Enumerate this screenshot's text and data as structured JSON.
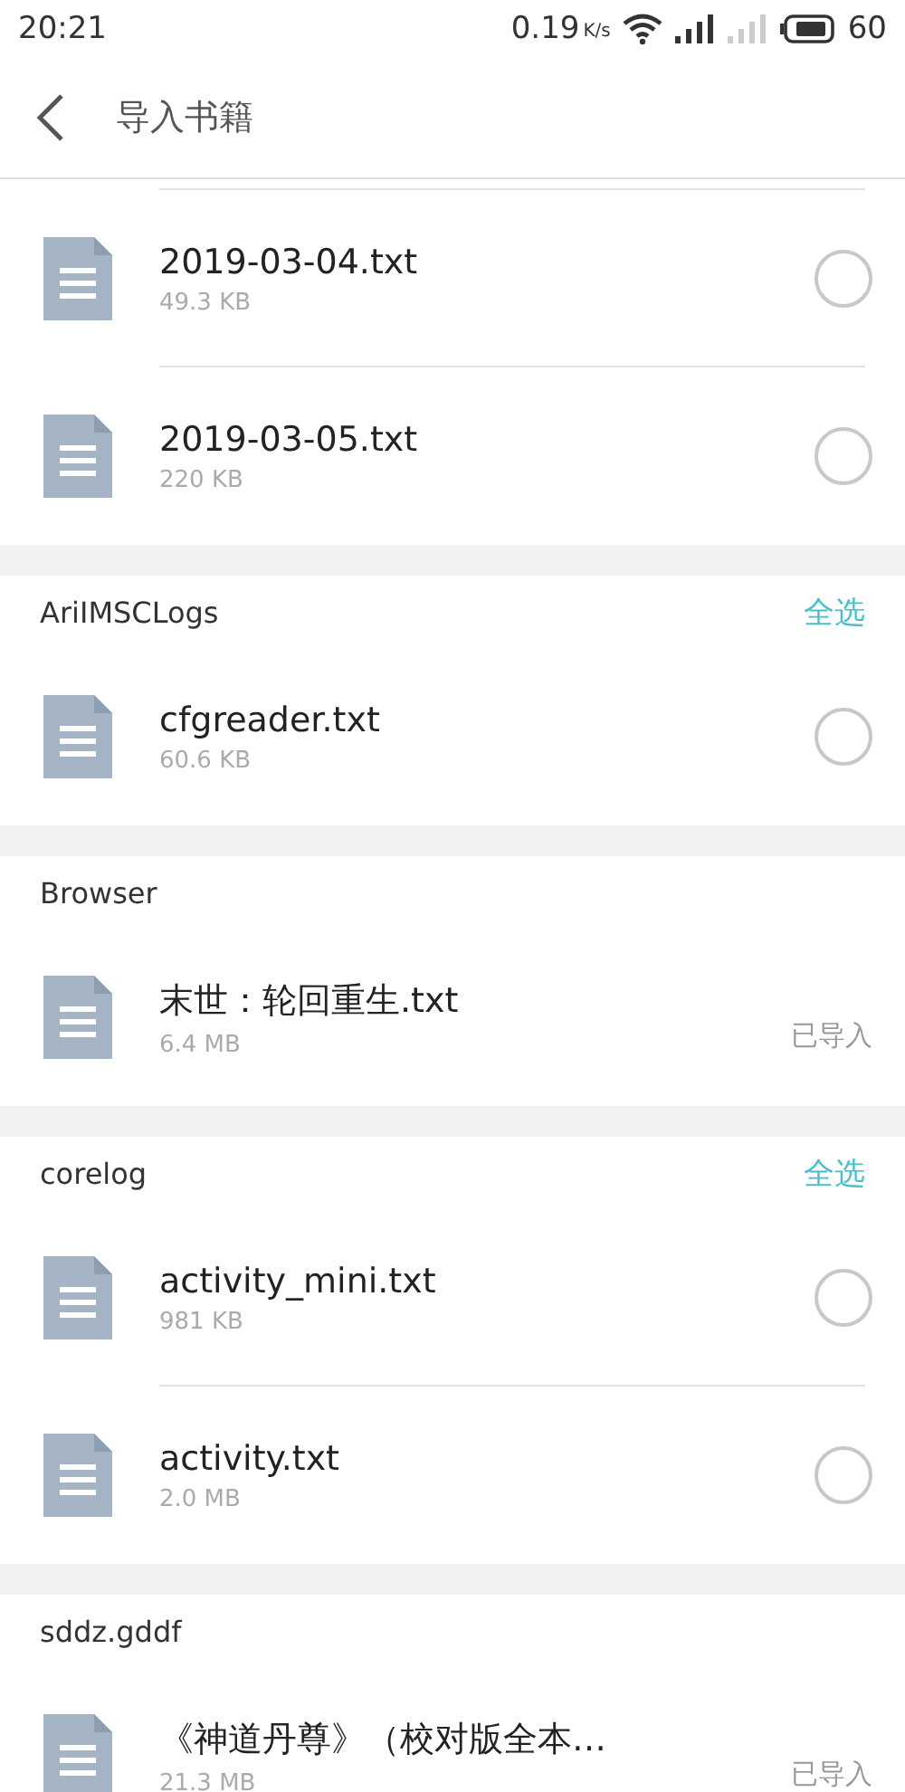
{
  "status_bar": {
    "time": "20:21",
    "speed": "0.19",
    "speed_unit": "K/s",
    "battery": "60"
  },
  "header": {
    "title": "导入书籍"
  },
  "sections": [
    {
      "files": [
        {
          "name": "2019-03-04.txt",
          "size": "49.3 KB",
          "kind": "select",
          "selected": false
        },
        {
          "name": "2019-03-05.txt",
          "size": "220 KB",
          "kind": "select",
          "selected": false
        }
      ]
    },
    {
      "title": "AriIMSCLogs",
      "select_all": "全选",
      "files": [
        {
          "name": "cfgreader.txt",
          "size": "60.6 KB",
          "kind": "select",
          "selected": false
        }
      ]
    },
    {
      "title": "Browser",
      "files": [
        {
          "name": "末世：轮回重生.txt",
          "size": "6.4 MB",
          "kind": "imported",
          "status": "已导入"
        }
      ]
    },
    {
      "title": "corelog",
      "select_all": "全选",
      "files": [
        {
          "name": "activity_mini.txt",
          "size": "981 KB",
          "kind": "select",
          "selected": false
        },
        {
          "name": "activity.txt",
          "size": "2.0 MB",
          "kind": "select",
          "selected": false
        }
      ]
    },
    {
      "title": "sddz.gddf",
      "files": [
        {
          "name": "《神道丹尊》（校对版全本…",
          "size": "21.3 MB",
          "kind": "imported",
          "status": "已导入"
        }
      ]
    }
  ]
}
